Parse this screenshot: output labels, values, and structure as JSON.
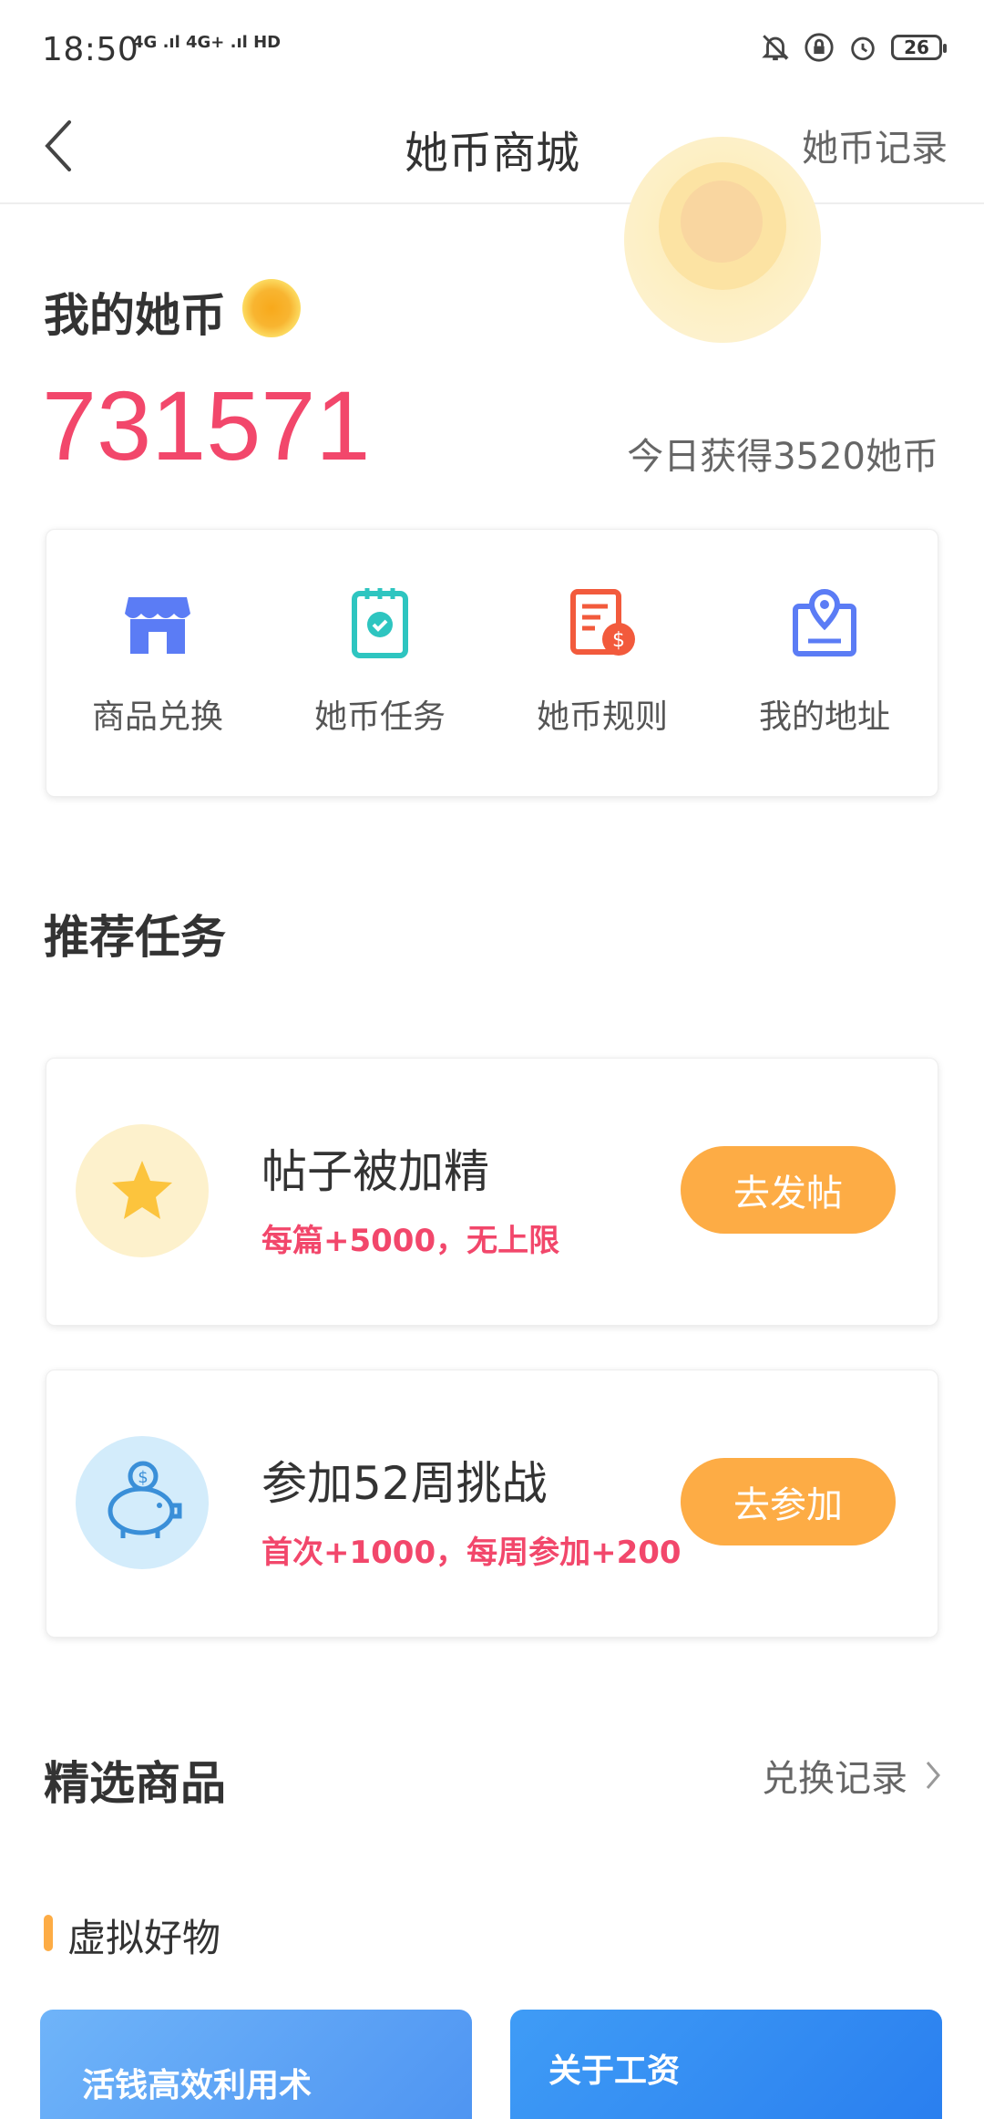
{
  "status": {
    "time": "18:50",
    "signal": "4G .ıl 4G+ .ıl HD",
    "battery": "26"
  },
  "nav": {
    "title": "她币商城",
    "right": "她币记录"
  },
  "hero": {
    "label": "我的她币",
    "value": "731571",
    "today": "今日获得3520她币"
  },
  "quick": [
    {
      "label": "商品兑换",
      "icon": "store-icon",
      "color": "#5b7cf5"
    },
    {
      "label": "她币任务",
      "icon": "task-checklist-icon",
      "color": "#2ec5c0"
    },
    {
      "label": "她币规则",
      "icon": "rules-document-icon",
      "color": "#f25a3c"
    },
    {
      "label": "我的地址",
      "icon": "location-pin-icon",
      "color": "#5b7cf5"
    }
  ],
  "recommended": {
    "title": "推荐任务",
    "tasks": [
      {
        "title": "帖子被加精",
        "subtitle": "每篇+5000，无上限",
        "button": "去发帖",
        "icon": "star-icon"
      },
      {
        "title": "参加52周挑战",
        "subtitle": "首次+1000，每周参加+200",
        "button": "去参加",
        "icon": "piggy-bank-icon"
      }
    ]
  },
  "goods": {
    "title": "精选商品",
    "link": "兑换记录",
    "category": "虚拟好物",
    "cards": [
      {
        "text": "活钱高效利用术"
      },
      {
        "text": "关于工资"
      }
    ]
  },
  "colors": {
    "accent": "#fdac45",
    "highlight": "#f2476b"
  }
}
